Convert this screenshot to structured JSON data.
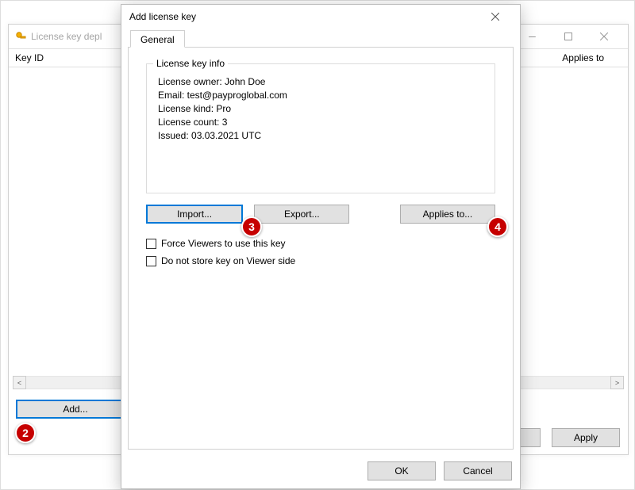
{
  "back": {
    "title_partial": "License key depl",
    "col_keyid": "Key ID",
    "col_applies": "Applies to",
    "add_label": "Add...",
    "apply_label": "Apply"
  },
  "dialog": {
    "title": "Add license key",
    "tab_general": "General",
    "fieldset_legend": "License key info",
    "owner": "License owner: John Doe",
    "email": "Email: test@payproglobal.com",
    "kind": "License kind: Pro",
    "count": "License count: 3",
    "issued": "Issued: 03.03.2021 UTC",
    "import_label": "Import...",
    "export_label": "Export...",
    "appliesto_label": "Applies to...",
    "chk_force": "Force Viewers to use this key",
    "chk_nostore": "Do not store key on Viewer side",
    "ok_label": "OK",
    "cancel_label": "Cancel"
  },
  "badges": {
    "b2": "2",
    "b3": "3",
    "b4": "4"
  }
}
